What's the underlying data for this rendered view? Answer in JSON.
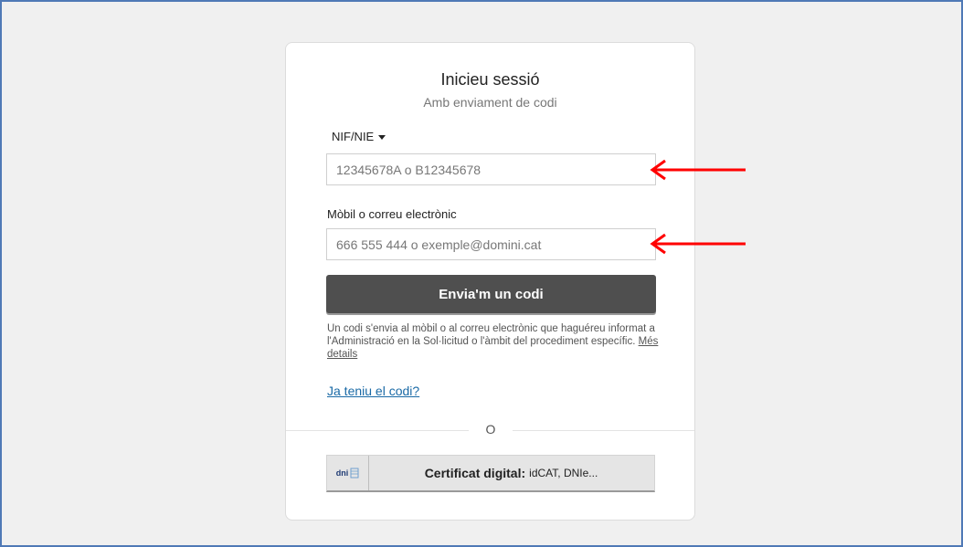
{
  "login": {
    "title": "Inicieu sessió",
    "subtitle": "Amb enviament de codi",
    "id_type_label": "NIF/NIE",
    "nif_placeholder": "12345678A o B12345678",
    "contact_label": "Mòbil o correu electrònic",
    "contact_placeholder": "666 555 444 o exemple@domini.cat",
    "send_button": "Envia'm un codi",
    "help_text": "Un codi s'envia al mòbil o al correu electrònic que haguéreu informat a l'Administració en la Sol·licitud o l'àmbit del procediment específic.",
    "help_link": "Més details",
    "have_code_link": "Ja teniu el codi?",
    "divider_text": "O",
    "cert_logo_text": "dni",
    "cert_button_bold": "Certificat digital:",
    "cert_button_rest": "idCAT, DNIe..."
  },
  "annotations": {
    "arrow_color": "#ff0000"
  },
  "colors": {
    "frame_border": "#4f79b6",
    "button_dark": "#4f4f4f",
    "link": "#1a6aa6"
  }
}
